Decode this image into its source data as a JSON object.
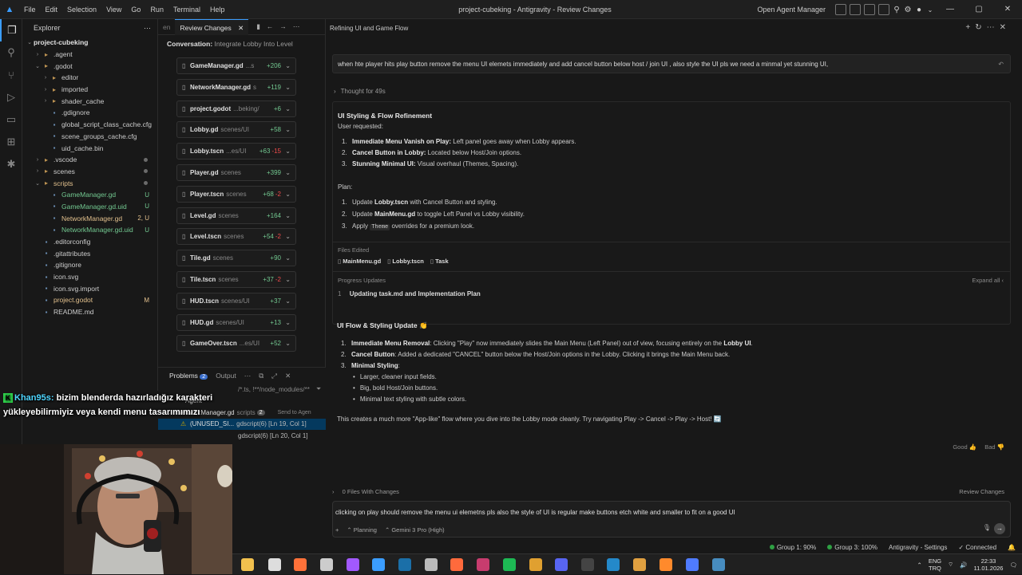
{
  "titlebar": {
    "menu": [
      "File",
      "Edit",
      "Selection",
      "View",
      "Go",
      "Run",
      "Terminal",
      "Help"
    ],
    "title": "project-cubeking - Antigravity - Review Changes",
    "open_agent_manager": "Open Agent Manager"
  },
  "explorer": {
    "header": "Explorer",
    "root": "project-cubeking",
    "items": [
      {
        "label": ".agent",
        "indent": 1,
        "type": "folder-closed",
        "color": "#cccccc"
      },
      {
        "label": ".godot",
        "indent": 1,
        "type": "folder-open",
        "color": "#cccccc"
      },
      {
        "label": "editor",
        "indent": 2,
        "type": "folder-closed",
        "color": "#cccccc"
      },
      {
        "label": "imported",
        "indent": 2,
        "type": "folder-closed",
        "color": "#cccccc"
      },
      {
        "label": "shader_cache",
        "indent": 2,
        "type": "folder-closed",
        "color": "#cccccc"
      },
      {
        "label": ".gdignore",
        "indent": 2,
        "type": "file",
        "color": "#cccccc"
      },
      {
        "label": "global_script_class_cache.cfg",
        "indent": 2,
        "type": "file",
        "color": "#cccccc"
      },
      {
        "label": "scene_groups_cache.cfg",
        "indent": 2,
        "type": "file",
        "color": "#cccccc"
      },
      {
        "label": "uid_cache.bin",
        "indent": 2,
        "type": "file",
        "color": "#cccccc"
      },
      {
        "label": ".vscode",
        "indent": 1,
        "type": "folder-closed",
        "color": "#cccccc",
        "dot": true
      },
      {
        "label": "scenes",
        "indent": 1,
        "type": "folder-closed",
        "color": "#cccccc",
        "dot": true
      },
      {
        "label": "scripts",
        "indent": 1,
        "type": "folder-open",
        "color": "#e2c08d",
        "dot": true
      },
      {
        "label": "GameManager.gd",
        "indent": 2,
        "type": "file",
        "color": "#73c991",
        "badge": "U"
      },
      {
        "label": "GameManager.gd.uid",
        "indent": 2,
        "type": "file",
        "color": "#73c991",
        "badge": "U"
      },
      {
        "label": "NetworkManager.gd",
        "indent": 2,
        "type": "file",
        "color": "#e2c08d",
        "badge": "2, U"
      },
      {
        "label": "NetworkManager.gd.uid",
        "indent": 2,
        "type": "file",
        "color": "#73c991",
        "badge": "U"
      },
      {
        "label": ".editorconfig",
        "indent": 1,
        "type": "file",
        "color": "#cccccc"
      },
      {
        "label": ".gitattributes",
        "indent": 1,
        "type": "file",
        "color": "#cccccc"
      },
      {
        "label": ".gitignore",
        "indent": 1,
        "type": "file",
        "color": "#cccccc"
      },
      {
        "label": "icon.svg",
        "indent": 1,
        "type": "file",
        "color": "#cccccc"
      },
      {
        "label": "icon.svg.import",
        "indent": 1,
        "type": "file",
        "color": "#cccccc"
      },
      {
        "label": "project.godot",
        "indent": 1,
        "type": "file",
        "color": "#e2c08d",
        "badge": "M"
      },
      {
        "label": "README.md",
        "indent": 1,
        "type": "file",
        "color": "#cccccc"
      }
    ]
  },
  "review": {
    "tab_prev": "en",
    "tab_active": "Review Changes",
    "conversation_label": "Conversation:",
    "conversation_title": "Integrate Lobby Into Level",
    "files": [
      {
        "name": "GameManager.gd",
        "path": "...s",
        "add": "+206",
        "del": ""
      },
      {
        "name": "NetworkManager.gd",
        "path": "s",
        "add": "+119",
        "del": ""
      },
      {
        "name": "project.godot",
        "path": "...beking/",
        "add": "+6",
        "del": ""
      },
      {
        "name": "Lobby.gd",
        "path": "scenes/UI",
        "add": "+58",
        "del": ""
      },
      {
        "name": "Lobby.tscn",
        "path": "...es/UI",
        "add": "+63",
        "del": "-15"
      },
      {
        "name": "Player.gd",
        "path": "scenes",
        "add": "+399",
        "del": ""
      },
      {
        "name": "Player.tscn",
        "path": "scenes",
        "add": "+68",
        "del": "-2"
      },
      {
        "name": "Level.gd",
        "path": "scenes",
        "add": "+164",
        "del": ""
      },
      {
        "name": "Level.tscn",
        "path": "scenes",
        "add": "+54",
        "del": "-2"
      },
      {
        "name": "Tile.gd",
        "path": "scenes",
        "add": "+90",
        "del": ""
      },
      {
        "name": "Tile.tscn",
        "path": "scenes",
        "add": "+37",
        "del": "-2"
      },
      {
        "name": "HUD.tscn",
        "path": "scenes/UI",
        "add": "+37",
        "del": ""
      },
      {
        "name": "HUD.gd",
        "path": "scenes/UI",
        "add": "+13",
        "del": ""
      },
      {
        "name": "GameOver.tscn",
        "path": "...es/UI",
        "add": "+52",
        "del": ""
      }
    ]
  },
  "problems": {
    "tab_problems": "Problems",
    "count": "2",
    "tab_output": "Output",
    "filter_text": "/*.ts, !**/node_modules/**",
    "agent_label": "Agent",
    "file_row": "NetworkManager.gd",
    "file_path": "scripts",
    "file_count": "2",
    "send_label": "Send to Agen",
    "row1_text": "(UNUSED_SI...",
    "row1_loc": "gdscript(6) [Ln 19, Col 1]",
    "row2_loc": "gdscript(6) [Ln 20, Col 1]"
  },
  "chat_overlay": {
    "name": "Khan95s:",
    "message": "bizim blenderda hazırladığız karakteri yükleyebilirmiyiz veya kendi menu tasarımımızı"
  },
  "main": {
    "header": "Refining UI and Game Flow",
    "user_message": "when hte player hits play button remove the menu UI elemets immediately and add cancel button below host / join UI , also style the UI pls we need a minmal yet stunning UI,",
    "thought": "Thought for 49s",
    "card1": {
      "title": "UI Styling & Flow Refinement",
      "subtitle": "User requested:",
      "requests": [
        {
          "num": "1.",
          "bold": "Immediate Menu Vanish on Play:",
          "text": " Left panel goes away when Lobby appears."
        },
        {
          "num": "2.",
          "bold": "Cancel Button in Lobby:",
          "text": " Located below Host/Join options."
        },
        {
          "num": "3.",
          "bold": "Stunning Minimal UI:",
          "text": " Visual overhaul (Themes, Spacing)."
        }
      ],
      "plan_label": "Plan:",
      "plan": [
        {
          "num": "1.",
          "pre": "Update ",
          "chip": "Lobby.tscn",
          "post": " with Cancel Button and styling."
        },
        {
          "num": "2.",
          "pre": "Update ",
          "chip": "MainMenu.gd",
          "post": " to toggle Left Panel vs Lobby visibility."
        },
        {
          "num": "3.",
          "pre": "Apply ",
          "chip": "Theme",
          "post": " overrides for a premium look."
        }
      ],
      "files_edited_label": "Files Edited",
      "files_edited": [
        "MainMenu.gd",
        "Lobby.tscn",
        "Task"
      ],
      "progress_label": "Progress Updates",
      "expand_all": "Expand all",
      "progress_num": "1",
      "progress_item": "Updating task.md and Implementation Plan"
    },
    "card2": {
      "title": "UI Flow & Styling Update 👏",
      "items": [
        {
          "num": "1.",
          "bold": "Immediate Menu Removal",
          "text": ": Clicking \"Play\" now immediately slides the Main Menu (Left Panel) out of view, focusing entirely on the ",
          "bold2": "Lobby UI",
          "text2": "."
        },
        {
          "num": "2.",
          "bold": "Cancel Button",
          "text": ": Added a dedicated \"CANCEL\" button below the Host/Join options in the Lobby. Clicking it brings the Main Menu back.",
          "bold2": "",
          "text2": ""
        },
        {
          "num": "3.",
          "bold": "Minimal Styling",
          "text": ":",
          "bold2": "",
          "text2": ""
        }
      ],
      "bullets": [
        "Larger, cleaner input fields.",
        "Big, bold Host/Join buttons.",
        "Minimal text styling with subtle colors."
      ],
      "summary": "This creates a much more \"App-like\" flow where you dive into the Lobby mode cleanly. Try navigating Play -> Cancel -> Play -> Host! 🔄"
    },
    "feedback_good": "Good",
    "feedback_bad": "Bad",
    "files_with_changes": "0 Files With Changes",
    "review_changes": "Review Changes",
    "input_text": "clicking on play should remove the menu ui elemetns pls also the style of UI is regular make buttons etch white and smaller to fit on a good UI",
    "mode": "Planning",
    "model": "Gemini 3 Pro (High)"
  },
  "statusbar": {
    "group1": "Group 1: 90%",
    "group3": "Group 3: 100%",
    "settings": "Antigravity - Settings",
    "connected": "Connected"
  },
  "taskbar": {
    "lang1": "ENG",
    "lang2": "TRQ",
    "time": "22:33",
    "date": "11.01.2026"
  }
}
